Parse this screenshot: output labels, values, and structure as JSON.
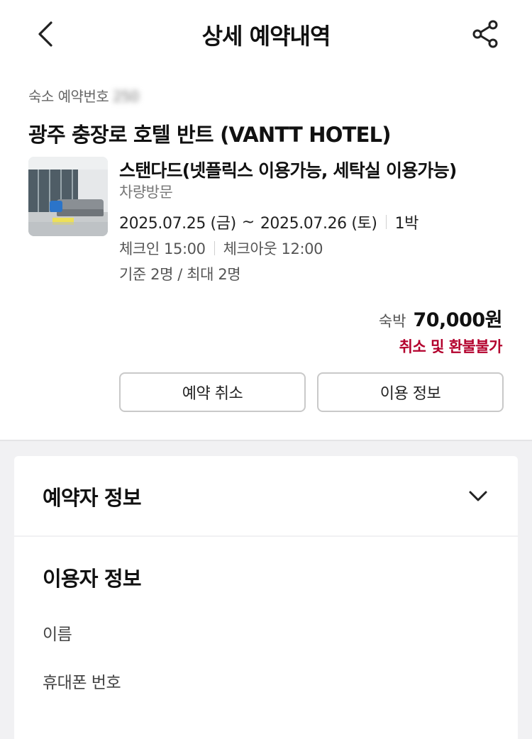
{
  "header": {
    "title": "상세 예약내역",
    "back_icon": "chevron-left-icon",
    "share_icon": "share-icon"
  },
  "reservation": {
    "number_label": "숙소 예약번호",
    "number_value": "250"
  },
  "hotel": {
    "name": "광주 충장로 호텔 반트 (VANTT HOTEL)"
  },
  "room": {
    "name": "스탠다드(넷플릭스 이용가능, 세탁실 이용가능)",
    "visit_type": "차량방문",
    "checkin_date": "2025.07.25 (금)",
    "date_separator": "~",
    "checkout_date": "2025.07.26 (토)",
    "nights": "1박",
    "checkin_time": "체크인 15:00",
    "checkout_time": "체크아웃 12:00",
    "capacity": "기준 2명 / 최대 2명"
  },
  "price": {
    "label": "숙박",
    "value": "70,000원",
    "refund_note": "취소 및 환불불가"
  },
  "actions": {
    "cancel_label": "예약 취소",
    "usage_label": "이용 정보"
  },
  "booker_section": {
    "title": "예약자 정보",
    "toggle_icon": "chevron-down-icon"
  },
  "user_section": {
    "title": "이용자 정보",
    "name_label": "이름",
    "phone_label": "휴대폰 번호"
  },
  "colors": {
    "accent_red": "#b3002d",
    "text_primary": "#111111",
    "text_secondary": "#777777",
    "band_bg": "#f1f1f3"
  }
}
